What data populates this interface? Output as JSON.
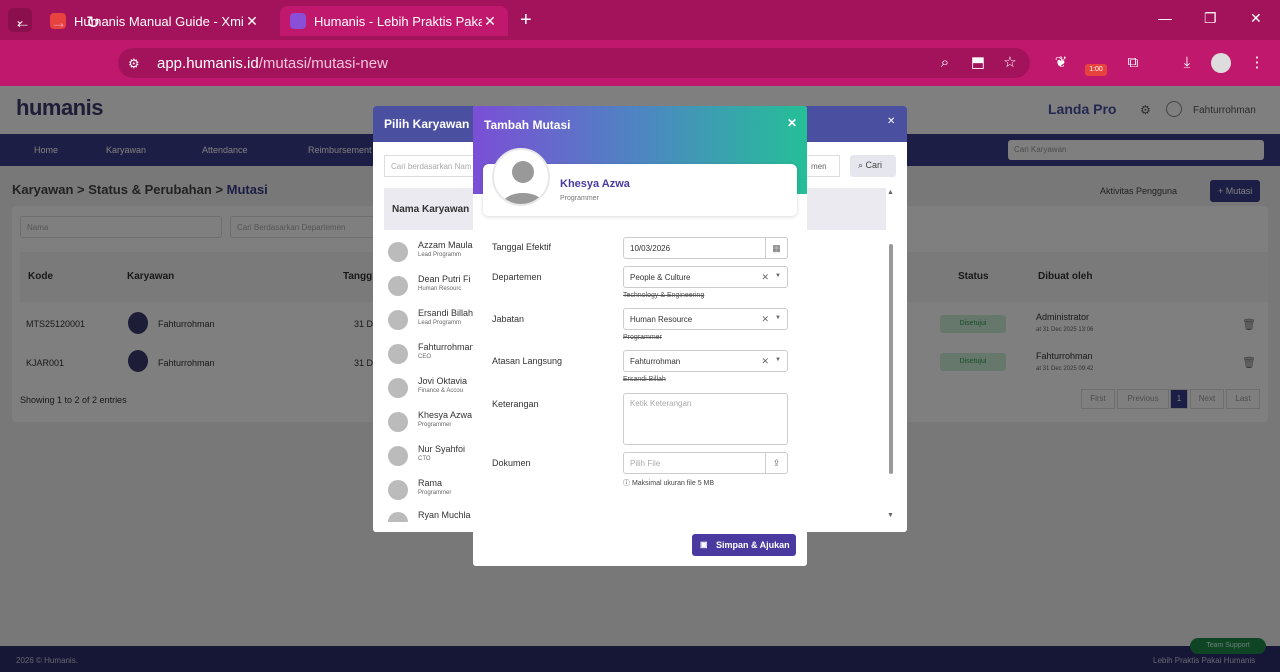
{
  "browser": {
    "tabs": [
      {
        "title": "Humanis Manual Guide - Xminc",
        "favicon_color": "#e8423f"
      },
      {
        "title": "Humanis - Lebih Praktis Pakai H",
        "favicon_color": "#8a4fd6"
      }
    ],
    "url_host": "app.humanis.id",
    "url_path": "/mutasi/mutasi-new",
    "badge": "1:00"
  },
  "app": {
    "logo": "humanis",
    "company": "Landa Pro",
    "user": "Fahturrohman",
    "menu": [
      "Home",
      "Karyawan",
      "Attendance",
      "Reimbursement"
    ],
    "header_search_placeholder": "Cari Karyawan",
    "breadcrumb": [
      "Karyawan",
      "Status & Perubahan",
      "Mutasi"
    ],
    "actions": {
      "activity": "Aktivitas Pengguna",
      "add": "+ Mutasi"
    },
    "filters": {
      "name": "Nama",
      "dept": "Cari Berdasarkan Departemen"
    },
    "table": {
      "headers": [
        "Kode",
        "Karyawan",
        "Tangg",
        "Status",
        "Dibuat oleh"
      ],
      "rows": [
        {
          "kode": "MTS25120001",
          "karyawan": "Fahturrohman",
          "tanggal": "31 De",
          "status": "Disetujui",
          "by": "Administrator",
          "at": "at 31 Dec 2025 13:06"
        },
        {
          "kode": "KJAR001",
          "karyawan": "Fahturrohman",
          "tanggal": "31 De",
          "status": "Disetujui",
          "by": "Fahturrohman",
          "at": "at 31 Dec 2025 09:42"
        }
      ],
      "info": "Showing 1 to 2 of 2 entries",
      "pager": [
        "First",
        "Previous",
        "1",
        "Next",
        "Last"
      ]
    },
    "footer_left": "2026 © Humanis.",
    "footer_right": "Lebih Praktis Pakai Humanis",
    "support": "Team Support"
  },
  "picker": {
    "title": "Pilih Karyawan",
    "search_placeholder": "Cari berdasarkan Nam",
    "dept_select": "men",
    "search_button": "Cari",
    "column": "Nama Karyawan",
    "employees": [
      {
        "name": "Azzam Maula",
        "role": "Lead Programm"
      },
      {
        "name": "Dean Putri Fi",
        "role": "Human Resourc"
      },
      {
        "name": "Ersandi Billah",
        "role": "Lead Programm"
      },
      {
        "name": "Fahturrohman",
        "role": "CEO"
      },
      {
        "name": "Jovi Oktavia",
        "role": "Finance & Accou"
      },
      {
        "name": "Khesya Azwa",
        "role": "Programmer"
      },
      {
        "name": "Nur Syahfoi",
        "role": "CTO"
      },
      {
        "name": "Rama",
        "role": "Programmer"
      },
      {
        "name": "Ryan Muchla",
        "role": ""
      }
    ]
  },
  "modal": {
    "title": "Tambah Mutasi",
    "employee_name": "Khesya Azwa",
    "employee_role": "Programmer",
    "labels": {
      "effective": "Tanggal Efektif",
      "department": "Departemen",
      "position": "Jabatan",
      "supervisor": "Atasan Langsung",
      "notes": "Keterangan",
      "document": "Dokumen"
    },
    "values": {
      "effective": "10/03/2026",
      "department": "People & Culture",
      "department_old": "Technology & Engineering",
      "position": "Human Resource",
      "position_old": "Programmer",
      "supervisor": "Fahturrohman",
      "supervisor_old": "Ersandi Billah"
    },
    "notes_placeholder": "Ketik Keterangan",
    "file_placeholder": "Pilih File",
    "file_note": "Maksimal ukuran file 5 MB",
    "save_button": "Simpan & Ajukan"
  }
}
